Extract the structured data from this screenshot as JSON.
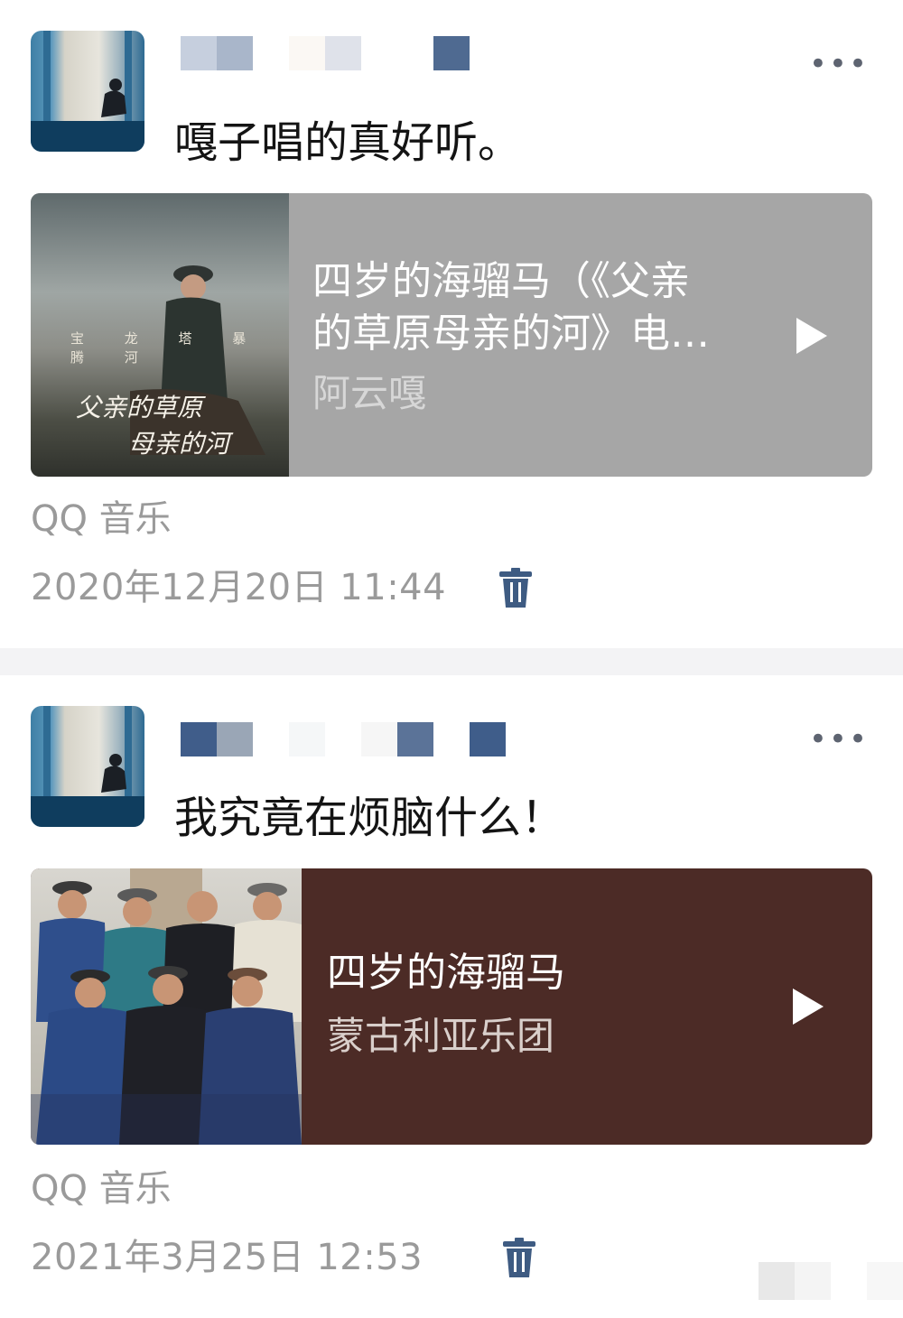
{
  "posts": [
    {
      "text": "嘎子唱的真好听。",
      "card": {
        "cover_calligraphy_line1": "父亲的草原",
        "cover_calligraphy_line2": "母亲的河",
        "cover_credits": "宝 龙 塔 暴 腾 河",
        "title_line1": "四岁的海骝马（《父亲",
        "title_line2": "的草原母亲的河》电…",
        "artist": "阿云嘎",
        "background_color": "#a6a6a6",
        "artist_color": "#d7d7d7"
      },
      "source": "QQ 音乐",
      "time": "2020年12月20日 11:44",
      "more_label": "•••"
    },
    {
      "text": "我究竟在烦脑什么！",
      "card": {
        "title_line1": "四岁的海骝马",
        "artist": "蒙古利亚乐团",
        "background_color": "#4c2b26",
        "artist_color": "#d9cfcb"
      },
      "source": "QQ 音乐",
      "time": "2021年3月25日 12:53",
      "more_label": "•••"
    }
  ],
  "icons": {
    "more": "more-icon",
    "play": "play-icon",
    "delete": "trash-icon"
  },
  "colors": {
    "name_pixel_blue": "#4c6a94",
    "meta_gray": "#9a9a9a",
    "trash_blue": "#3e5b82"
  }
}
